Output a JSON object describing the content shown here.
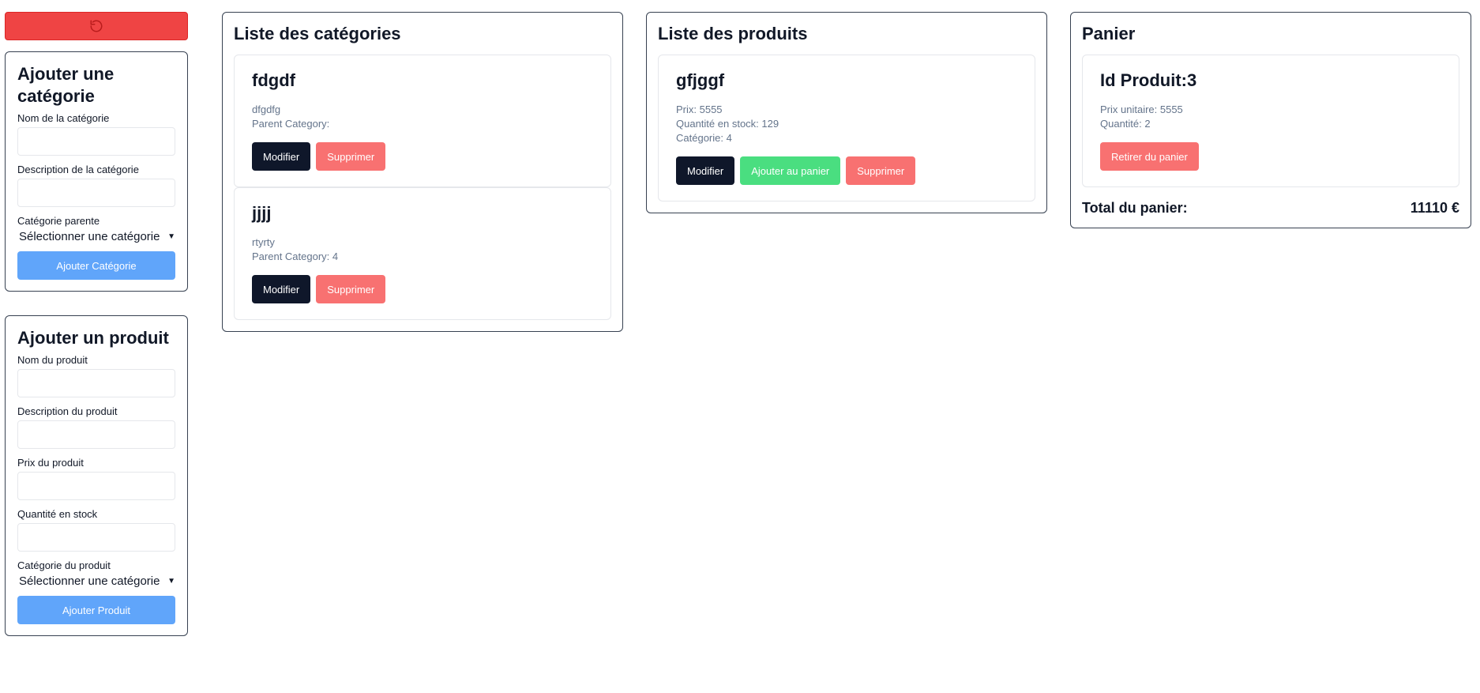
{
  "sidebar": {
    "reset_icon": "reload-icon",
    "reset_color": "#ef4444",
    "category_form": {
      "title": "Ajouter une catégorie",
      "name_label": "Nom de la catégorie",
      "description_label": "Description de la catégorie",
      "parent_label": "Catégorie parente",
      "parent_select": "Sélectionner une catégorie",
      "submit": "Ajouter Catégorie"
    },
    "product_form": {
      "title": "Ajouter un produit",
      "name_label": "Nom du produit",
      "description_label": "Description du produit",
      "price_label": "Prix du produit",
      "stock_label": "Quantité en stock",
      "category_label": "Catégorie du produit",
      "category_select": "Sélectionner une catégorie",
      "submit": "Ajouter Produit"
    }
  },
  "categories": {
    "title": "Liste des catégories",
    "items": [
      {
        "name": "fdgdf",
        "description": "dfgdfg",
        "parent": "Parent Category:",
        "edit": "Modifier",
        "delete": "Supprimer"
      },
      {
        "name": "jjjj",
        "description": "rtyrty",
        "parent": "Parent Category: 4",
        "edit": "Modifier",
        "delete": "Supprimer"
      }
    ]
  },
  "products": {
    "title": "Liste des produits",
    "items": [
      {
        "name": "gfjggf",
        "price": "Prix: 5555",
        "stock": "Quantité en stock: 129",
        "category": "Catégorie: 4",
        "edit": "Modifier",
        "add_to_cart": "Ajouter au panier",
        "delete": "Supprimer"
      }
    ]
  },
  "cart": {
    "title": "Panier",
    "items": [
      {
        "name": "Id Produit:3",
        "unit_price": "Prix unitaire: 5555",
        "quantity": "Quantité: 2",
        "remove": "Retirer du panier"
      }
    ],
    "total_label": "Total du panier:",
    "total_value": "11110 €"
  },
  "colors": {
    "danger": "#ef4444",
    "danger_light": "#f87171",
    "primary": "#60a5fa",
    "success": "#4ade80",
    "dark": "#0f172a"
  }
}
